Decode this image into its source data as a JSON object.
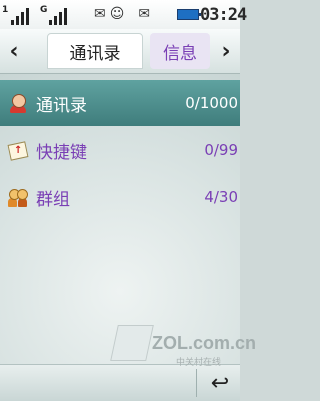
{
  "status_bar": {
    "sim1_label": "1",
    "sim2_label": "G",
    "time": "03:24",
    "icons": [
      "message-icon",
      "contact-status-icon",
      "message-alert-icon",
      "battery-icon"
    ]
  },
  "tabs": {
    "active_label": "通讯录",
    "next_label": "信息"
  },
  "list": {
    "items": [
      {
        "label": "通讯录",
        "count": "0/1000",
        "icon": "contacts-icon"
      },
      {
        "label": "快捷键",
        "count": "0/99",
        "icon": "shortcut-card-icon"
      },
      {
        "label": "群组",
        "count": "4/30",
        "icon": "group-icon"
      }
    ]
  },
  "bottom_bar": {
    "watermark": "ZOL.com.cn",
    "watermark_sub": "中关村在线",
    "back_icon": "back-arrow-icon"
  }
}
